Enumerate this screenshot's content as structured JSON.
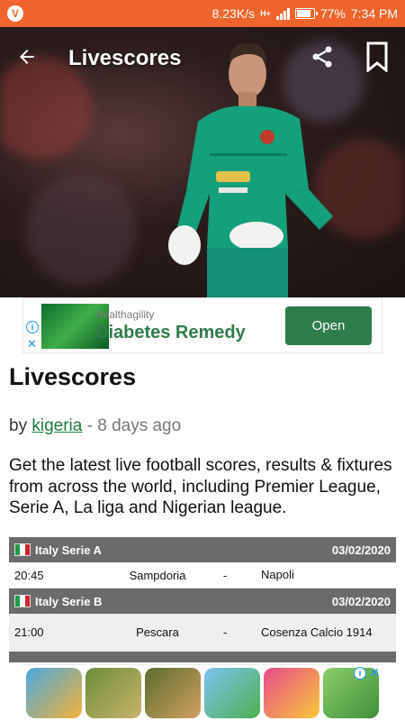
{
  "status_bar": {
    "speed": "8.23K/s",
    "network": "H+",
    "battery": "77%",
    "time": "7:34 PM"
  },
  "app_bar": {
    "title": "Livescores"
  },
  "ad": {
    "brand": "Healthagility",
    "headline": "Diabetes Remedy",
    "cta": "Open"
  },
  "article": {
    "title": "Livescores",
    "by_prefix": "by",
    "author": "kigeria",
    "time_sep": " - ",
    "time": "8 days ago",
    "intro": "Get the latest live football scores, results & fixtures from across the world, including Premier League, Serie A, La liga and Nigerian league."
  },
  "leagues": [
    {
      "name": "Italy Serie A",
      "date": "03/02/2020",
      "match": {
        "time": "20:45",
        "home": "Sampdoria",
        "sep": "-",
        "away": "Napoli"
      }
    },
    {
      "name": "Italy Serie B",
      "date": "03/02/2020",
      "match": {
        "time": "21:00",
        "home": "Pescara",
        "sep": "-",
        "away": "Cosenza Calcio 1914"
      }
    }
  ],
  "colors": {
    "status_bar": "#f0652e",
    "ad_green": "#2e7d4a",
    "league_header": "#6b6b6b",
    "author_link": "#1d7a3e"
  }
}
